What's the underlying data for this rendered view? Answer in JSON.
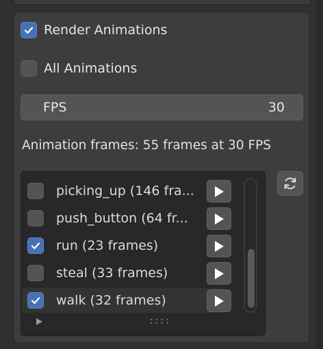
{
  "panel": {
    "render_animations": {
      "label": "Render Animations",
      "checked": true
    },
    "all_animations": {
      "label": "All Animations",
      "checked": false
    },
    "fps": {
      "label": "FPS",
      "value": "30"
    },
    "info": "Animation frames: 55 frames at 30 FPS"
  },
  "animation_list": {
    "items": [
      {
        "label": "picking_up (146 fra...",
        "checked": false
      },
      {
        "label": "push_button (64 fr...",
        "checked": false
      },
      {
        "label": "run (23 frames)",
        "checked": true
      },
      {
        "label": "steal (33 frames)",
        "checked": false
      },
      {
        "label": "walk (32 frames)",
        "checked": true
      }
    ],
    "grip": "::::"
  },
  "icons": {
    "check": "check-icon",
    "play": "play-icon",
    "refresh": "refresh-icon",
    "expand": "triangle-right-icon"
  },
  "colors": {
    "accent": "#4772b3",
    "panel_bg": "#3d3d3d",
    "window_bg": "#303030"
  }
}
